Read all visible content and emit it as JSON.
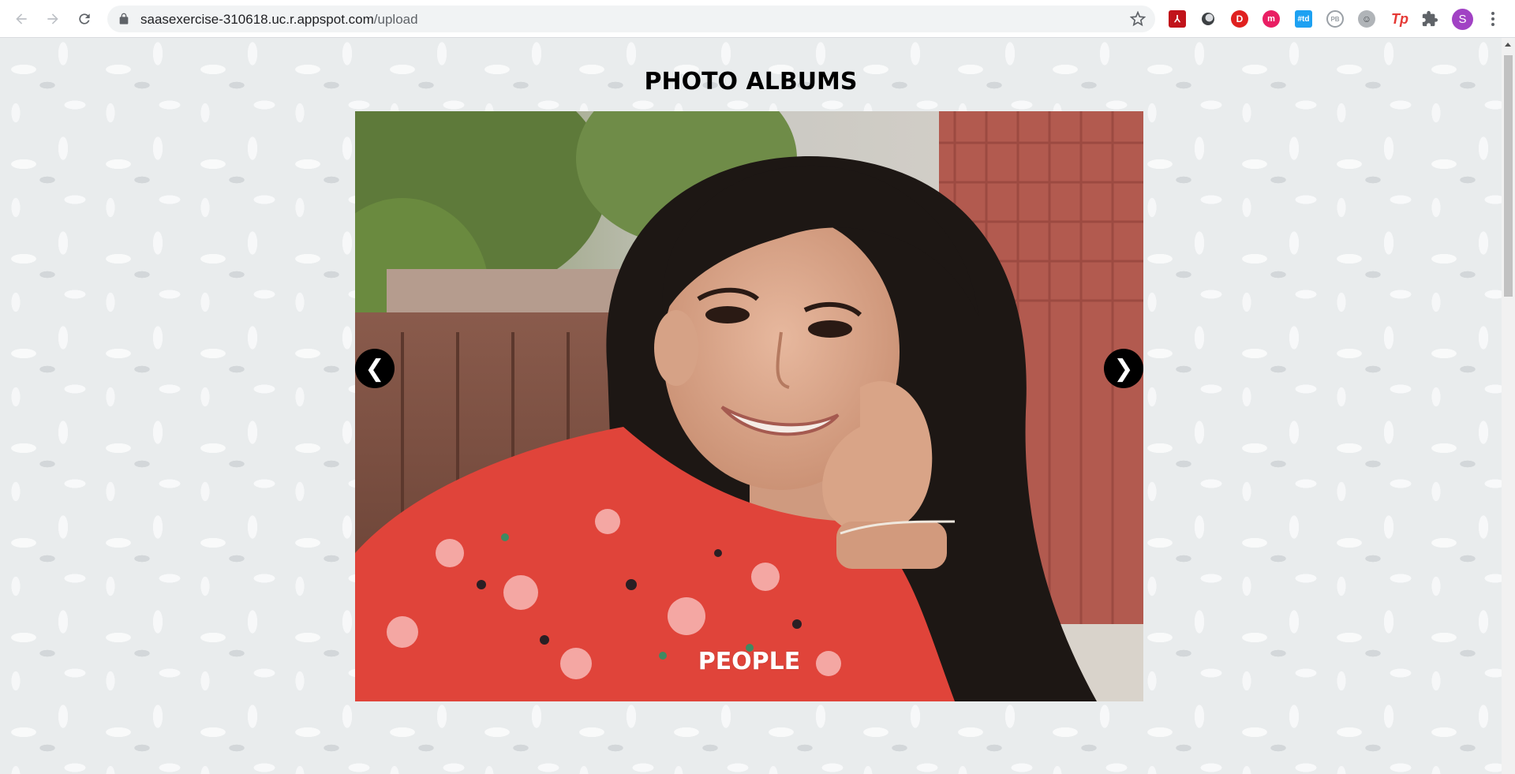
{
  "browser": {
    "url_host": "saasexercise-310618.uc.r.appspot.com",
    "url_path": "/upload",
    "extensions": [
      {
        "name": "adobe-acrobat",
        "label": "⅄"
      },
      {
        "name": "ring-extension",
        "label": ""
      },
      {
        "name": "d-extension",
        "label": "D"
      },
      {
        "name": "m-extension",
        "label": "m"
      },
      {
        "name": "td-extension",
        "label": "#td"
      },
      {
        "name": "pb-extension",
        "label": "PB"
      },
      {
        "name": "face-extension",
        "label": "☺"
      },
      {
        "name": "tp-extension",
        "label": "Tp"
      }
    ],
    "profile_initial": "S"
  },
  "page": {
    "title": "PHOTO ALBUMS",
    "slideshow": {
      "prev_label": "❮",
      "next_label": "❯",
      "caption": "PEOPLE"
    }
  },
  "colors": {
    "page_background": "#e9eced",
    "arrow_button": "#000000",
    "caption_text": "#ffffff",
    "shirt_red": "#e0443a"
  }
}
